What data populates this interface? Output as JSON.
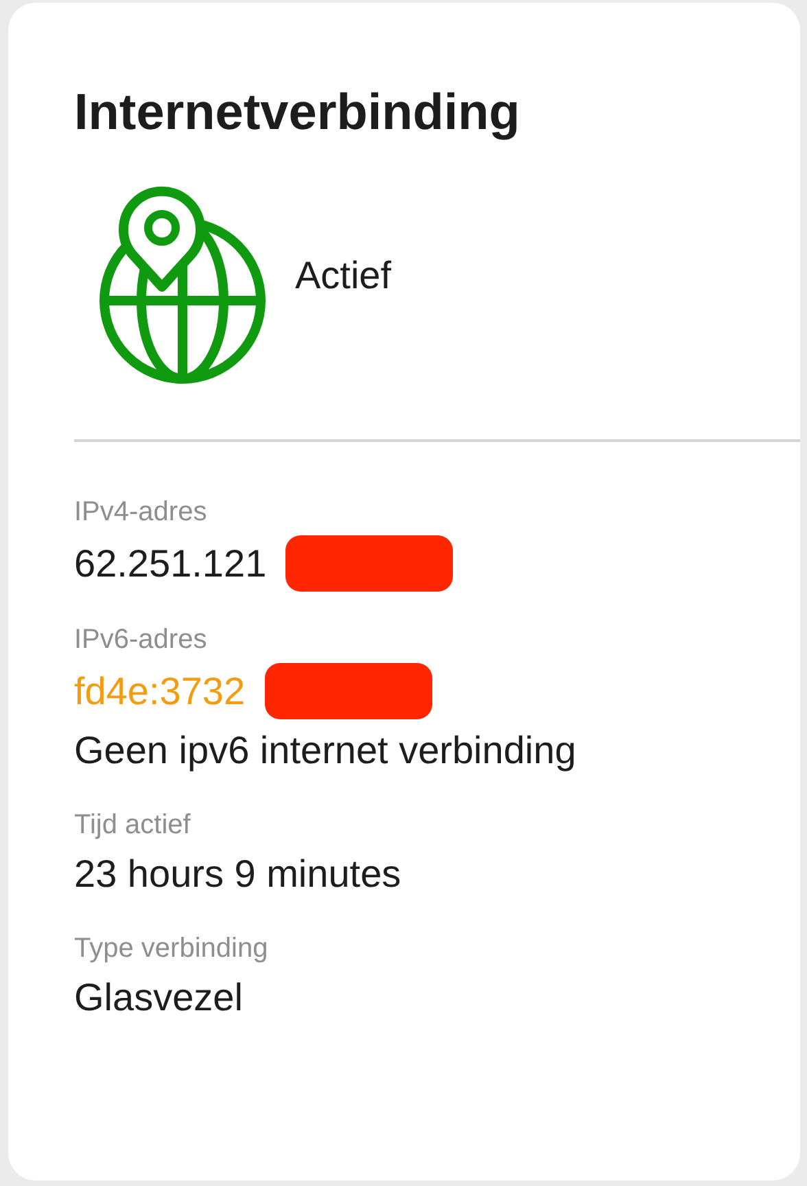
{
  "card": {
    "title": "Internetverbinding",
    "status": {
      "label": "Actief",
      "active": true
    }
  },
  "fields": [
    {
      "label": "IPv4-adres",
      "value": "62.251.121",
      "warning": false,
      "redacted": true
    },
    {
      "label": "IPv6-adres",
      "value": "fd4e:3732",
      "warning": true,
      "redacted": true,
      "note": "Geen ipv6 internet verbinding"
    },
    {
      "label": "Tijd actief",
      "value": "23 hours 9 minutes",
      "warning": false,
      "redacted": false
    },
    {
      "label": "Type verbinding",
      "value": "Glasvezel",
      "warning": false,
      "redacted": false
    }
  ]
}
